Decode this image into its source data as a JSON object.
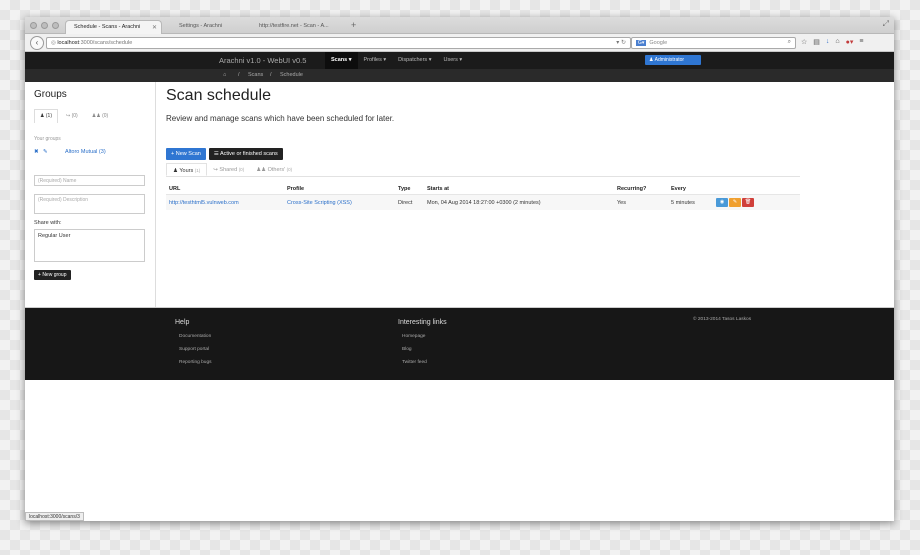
{
  "browser": {
    "tabs": [
      {
        "title": "Schedule - Scans - Arachni"
      },
      {
        "title": "Settings - Arachni"
      },
      {
        "title": "http://testfire.net - Scan - A..."
      }
    ],
    "url_host": "localhost",
    "url_path": ":3000/scans/schedule",
    "search_placeholder": "Google",
    "status_url": "localhost:3000/scans/3"
  },
  "app": {
    "brand": "Arachni v1.0 - WebUI v0.5",
    "menu": [
      "Scans ▾",
      "Profiles ▾",
      "Dispatchers ▾",
      "Users ▾"
    ],
    "admin_label": "Administrator",
    "breadcrumb": [
      "Scans",
      "Schedule"
    ]
  },
  "sidebar": {
    "title": "Groups",
    "tabs": [
      "(1)",
      "(0)",
      "(0)"
    ],
    "your_groups_label": "Your groups",
    "group_name": "Altoro Mutual (3)",
    "name_placeholder": "(Required) Name",
    "desc_placeholder": "(Required) Description",
    "share_label": "Share with:",
    "share_value": "Regular User",
    "new_group_label": "New group"
  },
  "main": {
    "title": "Scan schedule",
    "lead": "Review and manage scans which have been scheduled for later.",
    "new_scan_label": "New Scan",
    "active_label": "Active or finished scans",
    "tabs": [
      {
        "label": "Yours",
        "count": "(1)"
      },
      {
        "label": "Shared",
        "count": "(0)"
      },
      {
        "label": "Others'",
        "count": "(0)"
      }
    ],
    "columns": [
      "URL",
      "Profile",
      "Type",
      "Starts at",
      "Recurring?",
      "Every"
    ],
    "rows": [
      {
        "url": "http://testhtml5.vulnweb.com",
        "profile": "Cross-Site Scripting (XSS)",
        "type": "Direct",
        "starts_at": "Mon, 04 Aug 2014 18:27:00 +0300 (2 minutes)",
        "recurring": "Yes",
        "every": "5 minutes"
      }
    ]
  },
  "footer": {
    "help_title": "Help",
    "help_links": [
      "Documentation",
      "Support portal",
      "Reporting bugs"
    ],
    "links_title": "Interesting links",
    "links": [
      "Homepage",
      "Blog",
      "Twitter feed"
    ],
    "copyright": "© 2013-2014 Tasos Laskos"
  },
  "colors": {
    "primary": "#2f76d2",
    "warning": "#f0a030",
    "danger": "#d0403a",
    "info": "#4a9ad8",
    "header": "#1b1b1b"
  }
}
